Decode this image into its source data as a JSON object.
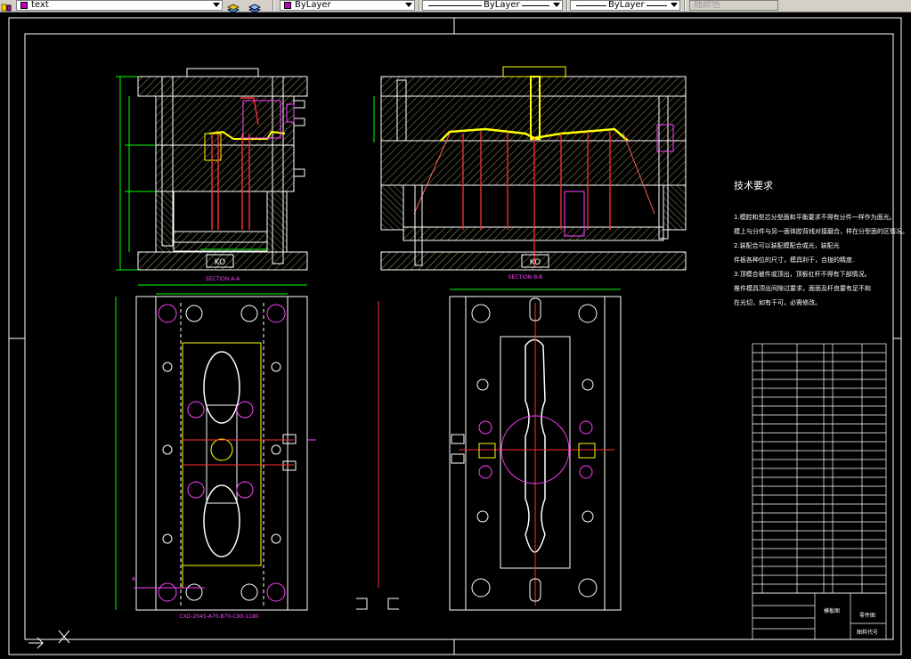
{
  "toolbar": {
    "layer_name": "text",
    "color_value": "ByLayer",
    "linetype_value": "ByLayer",
    "lineweight_value": "ByLayer",
    "plotstyle_value": "随颜色"
  },
  "drawing": {
    "section_a_label": "SECTION A-A",
    "section_b_label": "SECTION B-B",
    "ko_label_left": "KO",
    "ko_label_right": "KO",
    "mold_base_code": "CXD-2045-A70-B70-C90-1180",
    "section_marker_a": "A",
    "tech_title": "技术要求",
    "tech_lines": [
      "1.模腔和型芯分型面和平衡要求不得有分件一样作为面光。",
      "模上与分件与另一面体腔背线对接磨合，样在分型面的区情况。",
      "2.装配合可以装配模配合或光，装配光",
      "件板各种位的尺寸，模具利于，合拢的精度.",
      "3.顶模合被件或顶出，顶板杠杆不得有下部情况。",
      "推件模具顶出间隙过要求，面面及杆良要有足不和",
      "在光切，如有干可，必需修改。"
    ]
  },
  "title_block": {
    "part_name": "模板图",
    "drawing_name": "零件图",
    "drawing_code": "图样代号"
  }
}
